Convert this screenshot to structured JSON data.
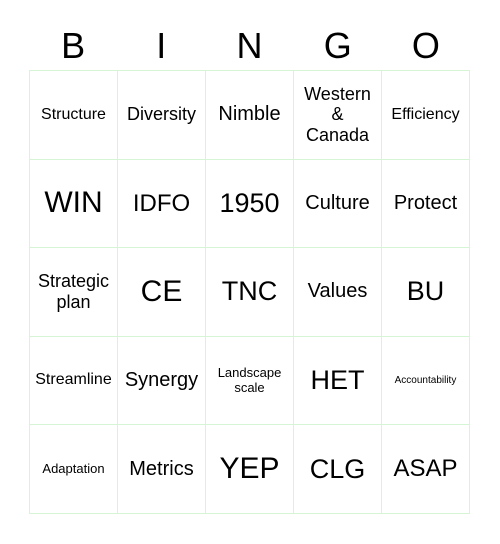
{
  "card": {
    "title": "BINGO",
    "columns": 5,
    "rows": 5,
    "border_color": "#d5f5d5",
    "text_color": "#000000",
    "background_color": "#ffffff"
  },
  "header": {
    "letters": [
      "B",
      "I",
      "N",
      "G",
      "O"
    ]
  },
  "grid": {
    "rows": [
      [
        {
          "text": "Structure",
          "size": "sm"
        },
        {
          "text": "Diversity",
          "size": "md"
        },
        {
          "text": "Nimble",
          "size": "lg"
        },
        {
          "text": "Western\n&\nCanada",
          "size": "md"
        },
        {
          "text": "Efficiency",
          "size": "sm"
        }
      ],
      [
        {
          "text": "WIN",
          "size": "3xl"
        },
        {
          "text": "IDFO",
          "size": "xl"
        },
        {
          "text": "1950",
          "size": "xxl"
        },
        {
          "text": "Culture",
          "size": "lg"
        },
        {
          "text": "Protect",
          "size": "lg"
        }
      ],
      [
        {
          "text": "Strategic\nplan",
          "size": "md"
        },
        {
          "text": "CE",
          "size": "3xl"
        },
        {
          "text": "TNC",
          "size": "xxl"
        },
        {
          "text": "Values",
          "size": "lg"
        },
        {
          "text": "BU",
          "size": "xxl"
        }
      ],
      [
        {
          "text": "Streamline",
          "size": "sm"
        },
        {
          "text": "Synergy",
          "size": "lg"
        },
        {
          "text": "Landscape\nscale",
          "size": "xs"
        },
        {
          "text": "HET",
          "size": "xxl"
        },
        {
          "text": "Accountability",
          "size": "xxs"
        }
      ],
      [
        {
          "text": "Adaptation",
          "size": "xs"
        },
        {
          "text": "Metrics",
          "size": "lg"
        },
        {
          "text": "YEP",
          "size": "3xl"
        },
        {
          "text": "CLG",
          "size": "xxl"
        },
        {
          "text": "ASAP",
          "size": "xl"
        }
      ]
    ]
  }
}
